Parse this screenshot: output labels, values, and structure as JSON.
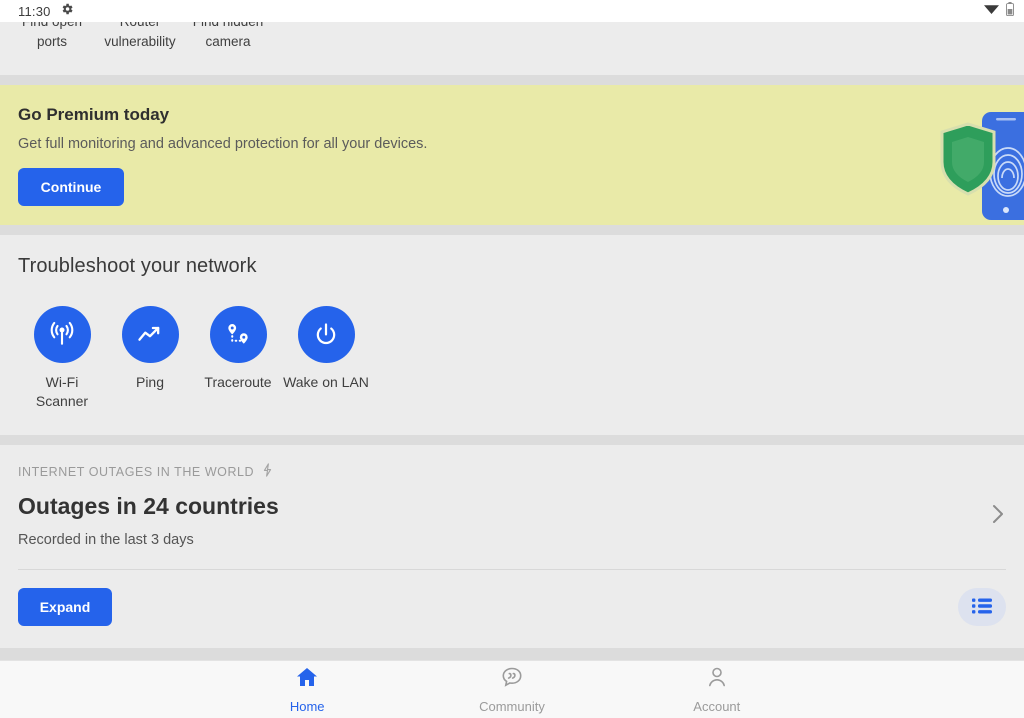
{
  "statusbar": {
    "time": "11:30",
    "icons": [
      "gear-icon",
      "wifi-icon",
      "battery-icon"
    ]
  },
  "clipped_row": {
    "items": [
      {
        "label": "Find open ports"
      },
      {
        "label": "Router vulnerability"
      },
      {
        "label": "Find hidden camera"
      }
    ]
  },
  "premium": {
    "title": "Go Premium today",
    "subtitle": "Get full monitoring and advanced protection for all your devices.",
    "cta_label": "Continue",
    "background_color": "#e9eaa8",
    "art": {
      "shield_color": "#2e9e5b",
      "phone_color": "#3b6fe0"
    }
  },
  "troubleshoot": {
    "title": "Troubleshoot your network",
    "tools": [
      {
        "label": "Wi-Fi Scanner",
        "icon": "wifi-signal-icon"
      },
      {
        "label": "Ping",
        "icon": "trending-up-icon"
      },
      {
        "label": "Traceroute",
        "icon": "map-pins-icon"
      },
      {
        "label": "Wake on LAN",
        "icon": "power-icon"
      }
    ]
  },
  "outages": {
    "kicker": "INTERNET OUTAGES IN THE WORLD",
    "kicker_icon": "lightning-bolt-icon",
    "title": "Outages in 24 countries",
    "subtitle": "Recorded in the last 3 days",
    "expand_label": "Expand",
    "list_icon": "list-icon",
    "chevron_icon": "chevron-right-icon"
  },
  "bottomnav": {
    "items": [
      {
        "label": "Home",
        "icon": "home-icon",
        "active": true
      },
      {
        "label": "Community",
        "icon": "chat-bubble-icon",
        "active": false
      },
      {
        "label": "Account",
        "icon": "person-icon",
        "active": false
      }
    ]
  },
  "colors": {
    "accent_blue": "#2563eb",
    "page_background": "#ececec",
    "divider": "#dcdcdc",
    "banner_yellow": "#e9eaa8"
  }
}
